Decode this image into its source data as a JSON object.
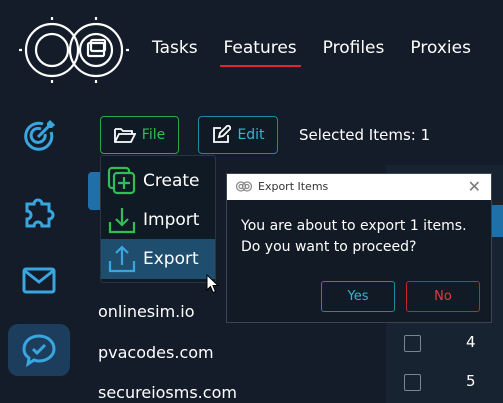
{
  "nav": {
    "tabs": [
      {
        "label": "Tasks",
        "active": false
      },
      {
        "label": "Features",
        "active": true
      },
      {
        "label": "Profiles",
        "active": false
      },
      {
        "label": "Proxies",
        "active": false
      }
    ]
  },
  "sidebar": {
    "items": [
      {
        "icon": "target-icon",
        "active": false
      },
      {
        "icon": "puzzle-icon",
        "active": false
      },
      {
        "icon": "mail-icon",
        "active": false
      },
      {
        "icon": "chat-check-icon",
        "active": true
      }
    ]
  },
  "toolbar": {
    "file_label": "File",
    "edit_label": "Edit",
    "selected_text": "Selected Items: 1"
  },
  "file_menu": {
    "items": [
      {
        "label": "Create",
        "icon": "plus-square-icon"
      },
      {
        "label": "Import",
        "icon": "download-icon"
      },
      {
        "label": "Export",
        "icon": "upload-icon",
        "hovered": true
      }
    ]
  },
  "list": {
    "items": [
      "onlinesim.io",
      "pvacodes.com",
      "secureiosms.com"
    ]
  },
  "table": {
    "rows": [
      {
        "number": "4"
      },
      {
        "number": "5"
      }
    ]
  },
  "dialog": {
    "title": "Export Items",
    "message_line1": "You are about to export 1 items.",
    "message_line2": "Do you want to proceed?",
    "yes_label": "Yes",
    "no_label": "No",
    "close_glyph": "✕"
  },
  "colors": {
    "background": "#131c28",
    "accent_red": "#e0262d",
    "accent_green": "#2aa84a",
    "accent_cyan": "#1f8aa0",
    "icon_blue": "#3aa6e0"
  }
}
